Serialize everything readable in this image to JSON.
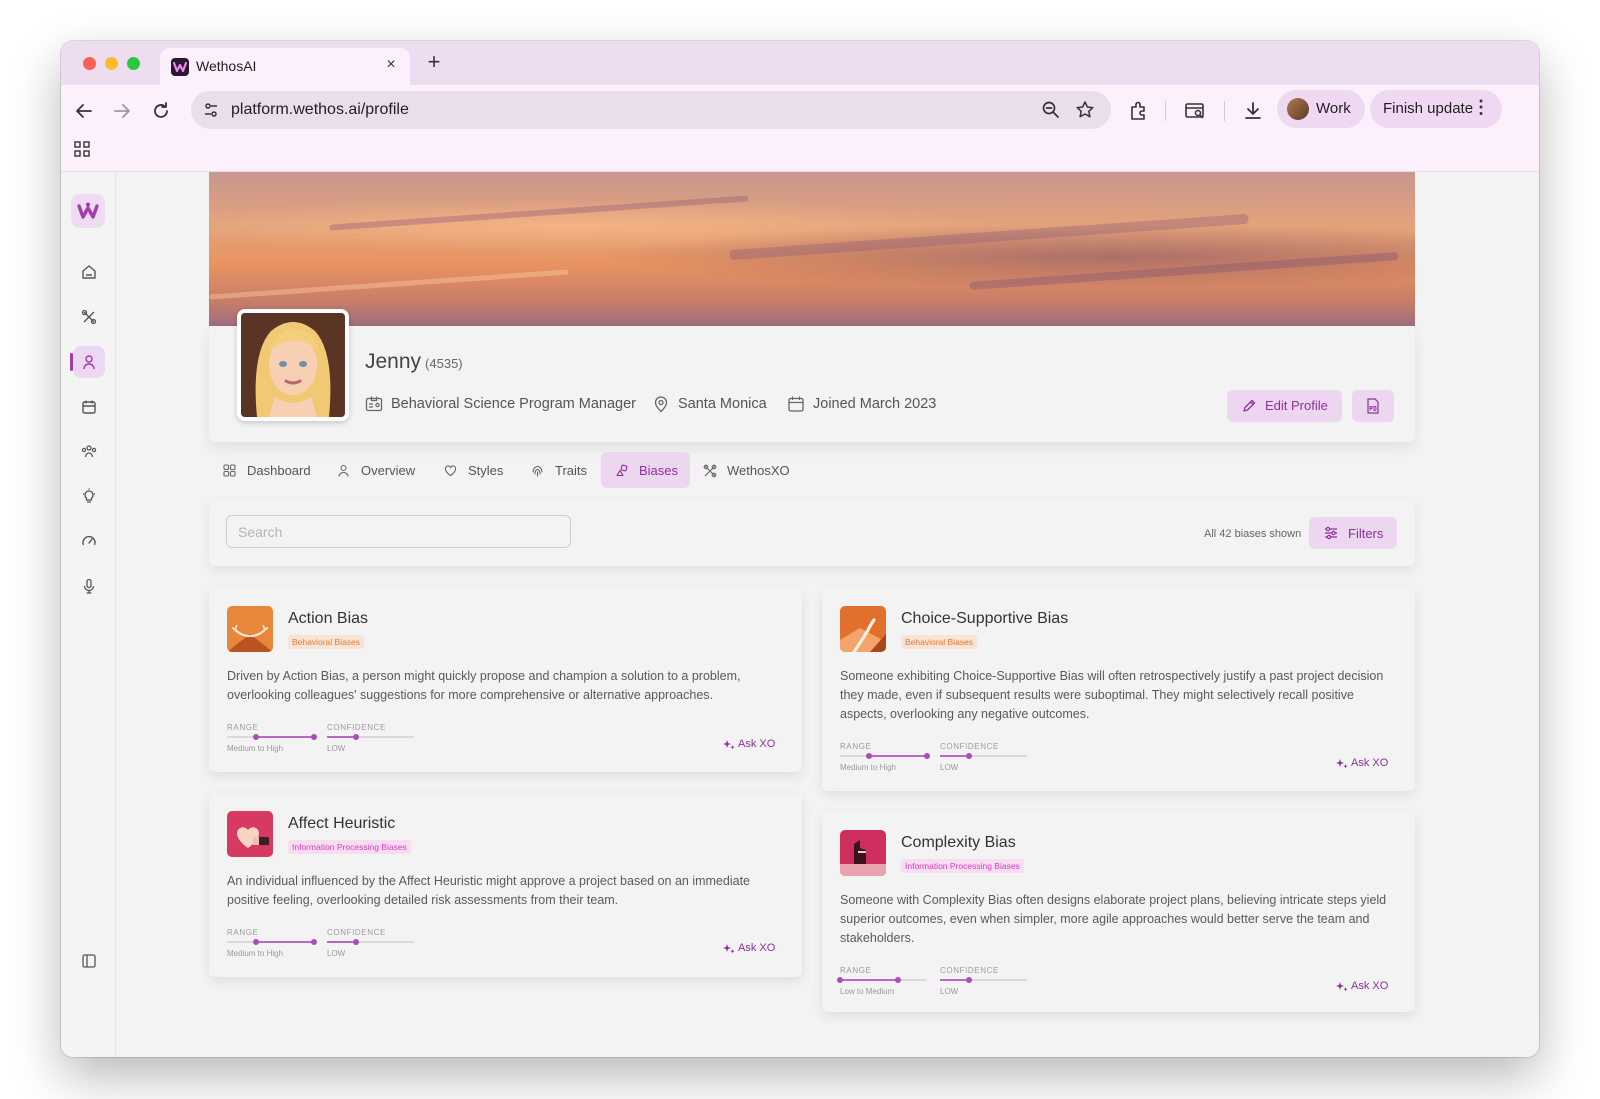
{
  "browser": {
    "tab_title": "WethosAI",
    "tab_close": "×",
    "new_tab": "+",
    "url": "platform.wethos.ai/profile",
    "profile_label": "Work",
    "update_label": "Finish update",
    "update_menu": "⋮"
  },
  "profile": {
    "name": "Jenny",
    "id": "(4535)",
    "role": "Behavioral Science Program Manager",
    "location": "Santa Monica",
    "joined": "Joined March 2023",
    "edit_label": "Edit Profile"
  },
  "tabs": [
    {
      "label": "Dashboard",
      "icon": "grid-icon"
    },
    {
      "label": "Overview",
      "icon": "person-icon"
    },
    {
      "label": "Styles",
      "icon": "heart-icon"
    },
    {
      "label": "Traits",
      "icon": "fingerprint-icon"
    },
    {
      "label": "Biases",
      "icon": "shapes-icon",
      "active": true
    },
    {
      "label": "WethosXO",
      "icon": "xo-icon"
    }
  ],
  "search": {
    "placeholder": "Search",
    "count_text": "All 42 biases shown",
    "filters_label": "Filters"
  },
  "meter_labels": {
    "range": "RANGE",
    "confidence": "CONFIDENCE"
  },
  "ask_label": "Ask XO",
  "biases": [
    {
      "title": "Action Bias",
      "tag": "Behavioral Biases",
      "description_lines": [
        "Driven by Action Bias, a person might quickly propose and champion a solution to a problem,",
        "overlooking colleagues' suggestions for more comprehensive or alternative approaches."
      ],
      "range_value": "Medium to High",
      "range_span": [
        0.33,
        1.0
      ],
      "confidence_value": "LOW",
      "confidence_level": 0.33
    },
    {
      "title": "Choice-Supportive Bias",
      "tag": "Behavioral Biases",
      "description_lines": [
        "Someone exhibiting Choice-Supportive Bias will often retrospectively justify a past project decision",
        "they made, even if subsequent results were suboptimal. They might selectively recall positive",
        "aspects, overlooking any negative outcomes."
      ],
      "range_value": "Medium to High",
      "range_span": [
        0.33,
        1.0
      ],
      "confidence_value": "LOW",
      "confidence_level": 0.33
    },
    {
      "title": "Affect Heuristic",
      "tag": "Information Processing Biases",
      "description_lines": [
        "An individual influenced by the Affect Heuristic might approve a project based on an immediate",
        "positive feeling, overlooking detailed risk assessments from their team."
      ],
      "range_value": "Medium to High",
      "range_span": [
        0.33,
        1.0
      ],
      "confidence_value": "LOW",
      "confidence_level": 0.33
    },
    {
      "title": "Complexity Bias",
      "tag": "Information Processing Biases",
      "description_lines": [
        "Someone with Complexity Bias often designs elaborate project plans, believing intricate steps yield",
        "superior outcomes, even when simpler, more agile approaches would better serve the team and",
        "stakeholders."
      ],
      "range_value": "Low to Medium",
      "range_span": [
        0.0,
        0.67
      ],
      "confidence_value": "LOW",
      "confidence_level": 0.33
    }
  ],
  "colors": {
    "accent": "#8e2f9c",
    "accent_bg": "#ecd6f0",
    "chrome": "#fbf0fb"
  }
}
